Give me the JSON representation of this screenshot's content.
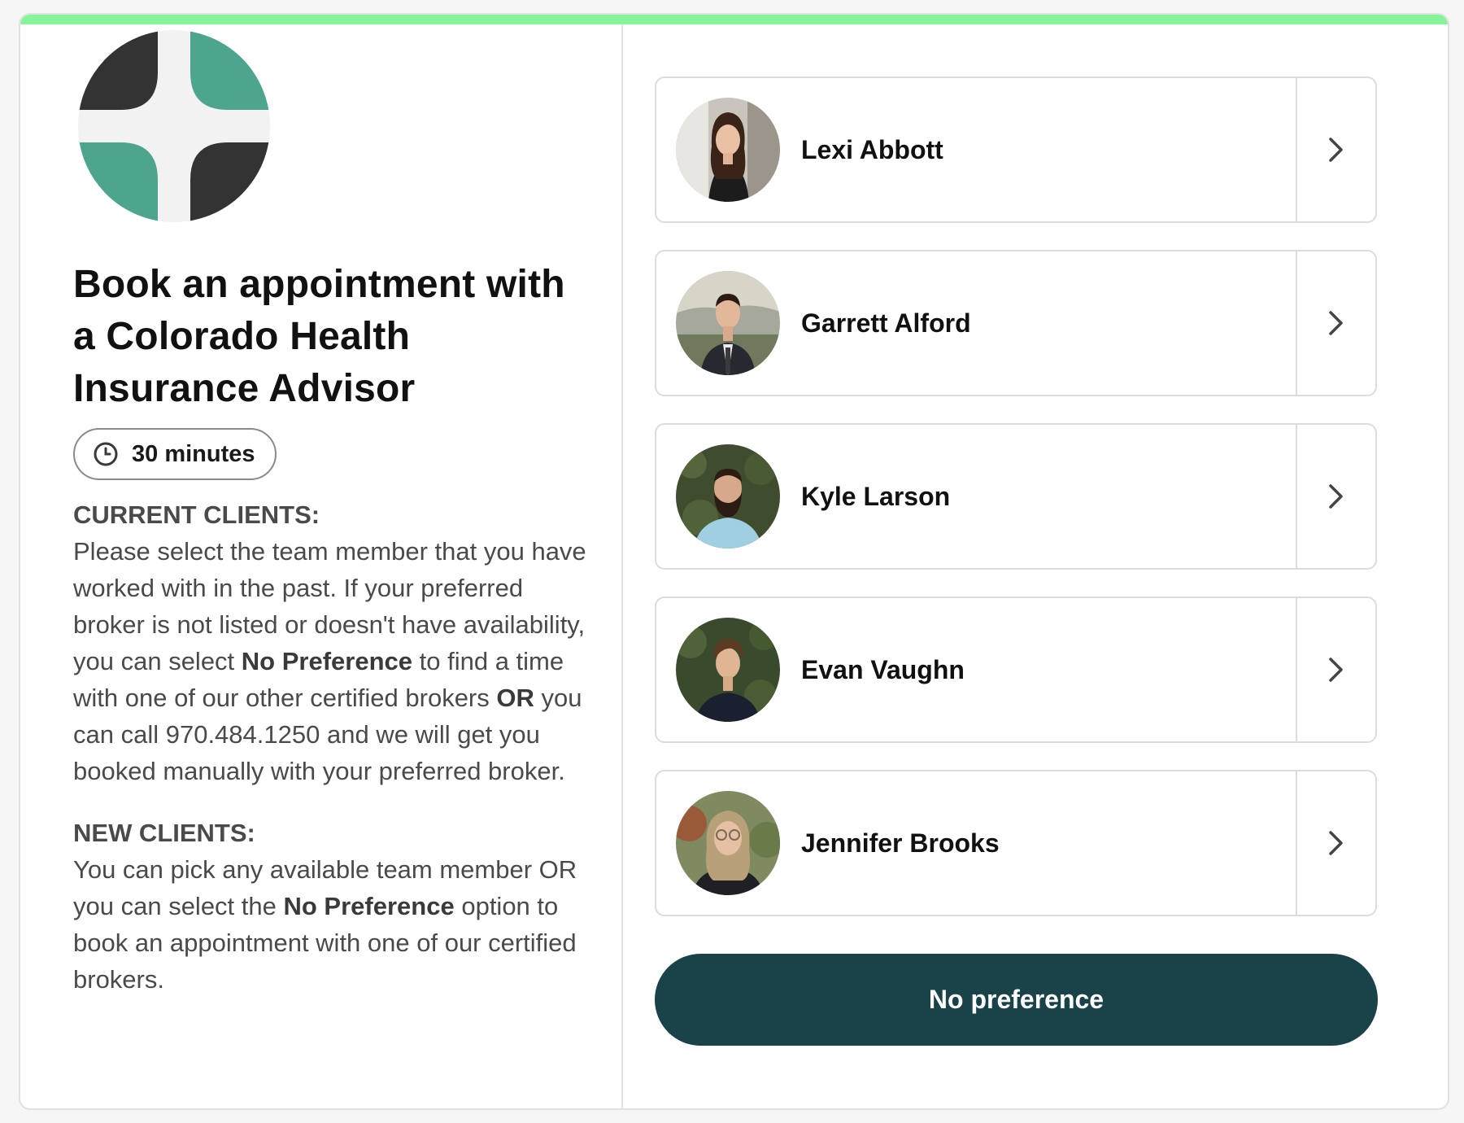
{
  "colors": {
    "accent_bar": "#86f59a",
    "primary_button": "#1a4249",
    "logo_green": "#4ca58c",
    "logo_dark": "#333333"
  },
  "header": {
    "logo_icon": "colorado-health-cross-logo",
    "title": "Book an appointment with a Colorado Health Insurance Advisor",
    "duration": {
      "icon": "clock-icon",
      "label": "30 minutes"
    }
  },
  "info": {
    "current_heading": "CURRENT CLIENTS:",
    "current_part1": "Please select the team member that you have worked with in the past. If your preferred broker is not listed or doesn't have availability, you can select ",
    "current_bold1": "No Preference",
    "current_part2": " to find a time with one of our other certified brokers ",
    "current_bold2": "OR",
    "current_part3": " you can call 970.484.1250 and we will get you booked manually with your preferred broker.",
    "new_heading": "NEW CLIENTS:",
    "new_part1": "You can pick any available team member OR you can select the ",
    "new_bold1": "No Preference",
    "new_part2": " option to book an appointment with one of our certified brokers."
  },
  "brokers": [
    {
      "name": "Lexi Abbott"
    },
    {
      "name": "Garrett Alford"
    },
    {
      "name": "Kyle Larson"
    },
    {
      "name": "Evan Vaughn"
    },
    {
      "name": "Jennifer Brooks"
    }
  ],
  "no_preference_label": "No preference"
}
